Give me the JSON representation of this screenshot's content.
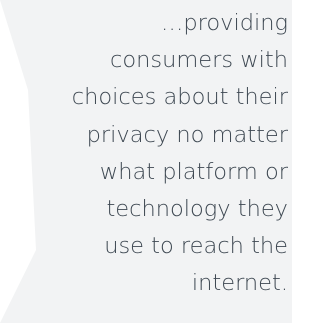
{
  "quote": {
    "lines": [
      "…providing",
      "consumers with",
      "choices about their",
      "privacy no matter",
      "what platform or",
      "technology they",
      "use to reach the",
      "internet."
    ]
  },
  "colors": {
    "background": "#ffffff",
    "panel": "#f2f3f4",
    "text": "#3e4852"
  }
}
